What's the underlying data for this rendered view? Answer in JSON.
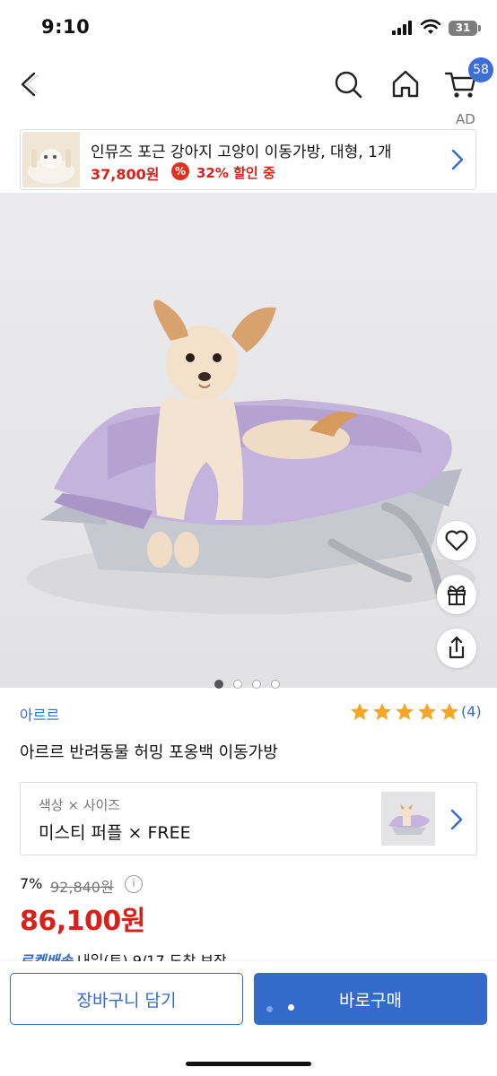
{
  "status_bar": {
    "time": "9:10",
    "battery": "31"
  },
  "nav": {
    "cart_count": "58",
    "ad_label": "AD"
  },
  "ad_banner": {
    "title": "인뮤즈 포근 강아지 고양이 이동가방, 대형, 1개",
    "price": "37,800원",
    "discount_icon": "%",
    "discount": "32% 할인 중"
  },
  "gallery": {
    "total_images": 4,
    "active_index": 0
  },
  "product": {
    "brand": "아르르",
    "rating_stars": 5,
    "review_count": "(4)",
    "name": "아르르 반려동물 허밍 포옹백 이동가방"
  },
  "option": {
    "label": "색상 × 사이즈",
    "value": "미스티 퍼플 × FREE"
  },
  "pricing": {
    "discount_rate": "7%",
    "original_price": "92,840원",
    "info_icon": "i",
    "sale_price": "86,100원"
  },
  "delivery": {
    "badge": "로켓배송",
    "text": "내일(토) 9/17 도착 보장"
  },
  "actions": {
    "cart_label": "장바구니 담기",
    "buy_label": "바로구매"
  },
  "colors": {
    "accent": "#346aca",
    "price_red": "#d8211b",
    "star": "#f5a623",
    "badge_blue": "#3b6fd9"
  }
}
